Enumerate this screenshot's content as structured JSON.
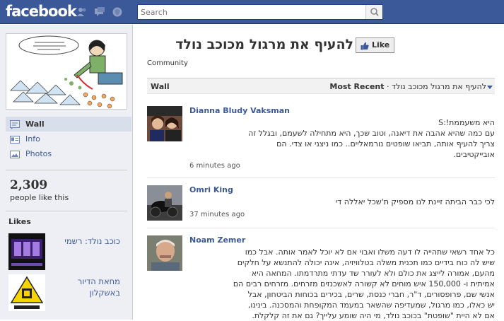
{
  "topbar": {
    "logo": "facebook",
    "search_placeholder": "Search",
    "icons": [
      "friends-icon",
      "messages-icon",
      "notifications-icon",
      "search-icon"
    ]
  },
  "sidebar": {
    "nav": [
      {
        "label": "Wall",
        "icon": "wall-icon",
        "active": true
      },
      {
        "label": "Info",
        "icon": "info-icon",
        "active": false
      },
      {
        "label": "Photos",
        "icon": "photos-icon",
        "active": false
      }
    ],
    "likes_count": "2,309",
    "likes_label": "people like this",
    "likes_title": "Likes",
    "liked_pages": [
      {
        "name": "כוכב נולד: רשמי"
      },
      {
        "name": "מחאת הדיור באשקלון"
      }
    ]
  },
  "page": {
    "title": "להעיף את מרגול מכוכב נולד",
    "like_button": "Like",
    "category": "Community"
  },
  "wall": {
    "tab_label": "Wall",
    "filter_page": "להעיף את מרגול מכוכב נולד",
    "filter_sep": "·",
    "filter_sort": "Most Recent"
  },
  "posts": [
    {
      "author": "Dianna Bludy Vaksman",
      "lines": [
        "היא משעממת!:S",
        "עם כמה שהיא אהבה את דיאנה, וטוב שכך, היא מתחילה לשעמם, ובגלל זה",
        "צריך להעיף אותה, תביאו שופטים נורמאליים.. כמו ניצני או צדי. הם",
        "אובייקטיבים."
      ],
      "time": "6 minutes ago"
    },
    {
      "author": "Omri King",
      "lines": [
        "לכי כבר הביתה זיינת לנו מספיק ת'שכל יאללה די"
      ],
      "time": "37 minutes ago"
    },
    {
      "author": "Noam Zemer",
      "lines": [
        "כל אחד רשאי שתהייה לו דעה משלו ואבוי אם לא יוכל לאמר אותה. אבל כמו",
        "שיש לה כוח בידיים כמו תכנית משלה בטלוויזיה, אינה יכולה להתנשא על חלקים",
        "מהעם, אמורה לייצג את כולם ולא לעורר שד עדתי מתרדמתו. המחאה היא",
        "אמיתית ו- 150,000 איש מוחים לא קשורה לאשכנזים מזרחים. מזרחים רבים הם",
        "אנשי שם, פרופסורים, ד\"ר, חברי כנסת, שרים, בכירים בכוחות הביטחון, אבל",
        "יש כאלו, כמו מרגול, שמעדיפה שהשאר במעמד המקופחת והמסכנה. בינינו,",
        "אם לא היית \"שופטת\" בכוכב נולד, מי היה שומע עלייך? גם את זה קלקלת."
      ]
    }
  ]
}
